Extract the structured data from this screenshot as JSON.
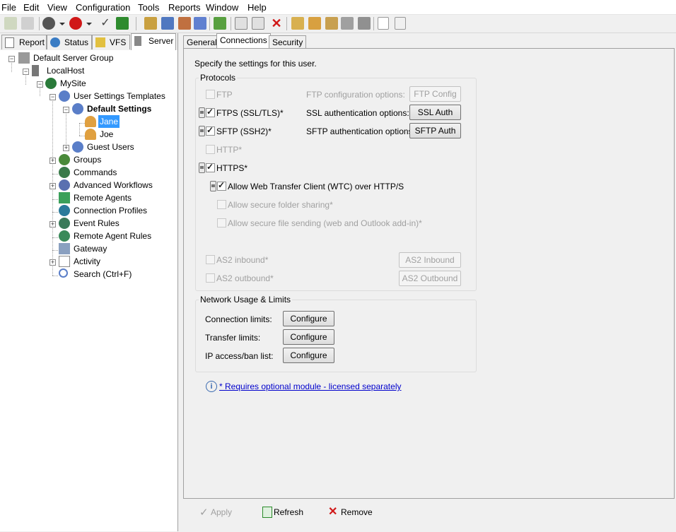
{
  "menu": {
    "items": [
      "File",
      "Edit",
      "View",
      "Configuration",
      "Tools",
      "Reports",
      "Window",
      "Help"
    ]
  },
  "toolbar": {
    "icons": [
      "connect-icon",
      "disconnect-icon",
      "server-icon",
      "stop-icon",
      "check-icon",
      "refresh-icon",
      "users-icon",
      "settings-icon",
      "groups-icon",
      "export-icon",
      "user-icon",
      "import-icon",
      "export2-icon",
      "delete-icon",
      "report1-icon",
      "report2-icon",
      "report3-icon",
      "report4-icon",
      "tools-icon",
      "new-icon",
      "blank-icon"
    ]
  },
  "left_tabs": [
    "Report",
    "Status",
    "VFS",
    "Server"
  ],
  "tree": [
    {
      "label": "Default Server Group"
    },
    {
      "label": "LocalHost"
    },
    {
      "label": "MySite"
    },
    {
      "label": "User Settings Templates"
    },
    {
      "label": "Default Settings"
    },
    {
      "label": "Jane"
    },
    {
      "label": "Joe"
    },
    {
      "label": "Guest Users"
    },
    {
      "label": "Groups"
    },
    {
      "label": "Commands"
    },
    {
      "label": "Advanced Workflows"
    },
    {
      "label": "Remote Agents"
    },
    {
      "label": "Connection Profiles"
    },
    {
      "label": "Event Rules"
    },
    {
      "label": "Remote Agent Rules"
    },
    {
      "label": "Gateway"
    },
    {
      "label": "Activity"
    },
    {
      "label": "Search (Ctrl+F)"
    }
  ],
  "right_tabs": [
    "General",
    "Connections",
    "Security"
  ],
  "intro": "Specify the settings for this user.",
  "protocols": {
    "group_label": "Protocols",
    "ftp": "FTP",
    "ftp_options_label": "FTP configuration options:",
    "ftp_config_btn": "FTP Config",
    "ftps": "FTPS (SSL/TLS)*",
    "ssl_options_label": "SSL authentication options:",
    "ssl_auth_btn": "SSL Auth",
    "sftp": "SFTP (SSH2)*",
    "sftp_options_label": "SFTP authentication options:",
    "sftp_auth_btn": "SFTP Auth",
    "http": "HTTP*",
    "https": "HTTPS*",
    "wtc": "Allow Web Transfer Client  (WTC) over HTTP/S",
    "folder_sharing": "Allow secure folder sharing*",
    "file_sending": "Allow secure file sending (web and Outlook add-in)*",
    "as2_in": "AS2 inbound*",
    "as2_in_btn": "AS2 Inbound",
    "as2_out": "AS2 outbound*",
    "as2_out_btn": "AS2 Outbound"
  },
  "network": {
    "group_label": "Network Usage & Limits",
    "connection_limits": "Connection limits:",
    "transfer_limits": "Transfer limits:",
    "ip_list": "IP access/ban list:",
    "configure": "Configure"
  },
  "note": "* Requires optional module - licensed separately",
  "bottom": {
    "apply": "Apply",
    "refresh": "Refresh",
    "remove": "Remove"
  }
}
